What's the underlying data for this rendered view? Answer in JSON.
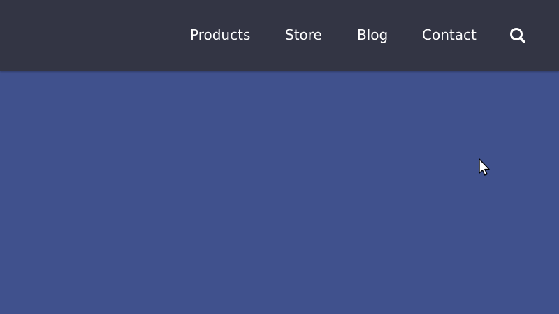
{
  "nav": {
    "items": [
      {
        "label": "Products"
      },
      {
        "label": "Store"
      },
      {
        "label": "Blog"
      },
      {
        "label": "Contact"
      }
    ],
    "search_icon": "search-icon"
  },
  "colors": {
    "header_bg": "#333544",
    "hero_bg": "#40518d",
    "nav_text": "#ffffff"
  },
  "cursor_icon": "mouse-pointer-icon"
}
